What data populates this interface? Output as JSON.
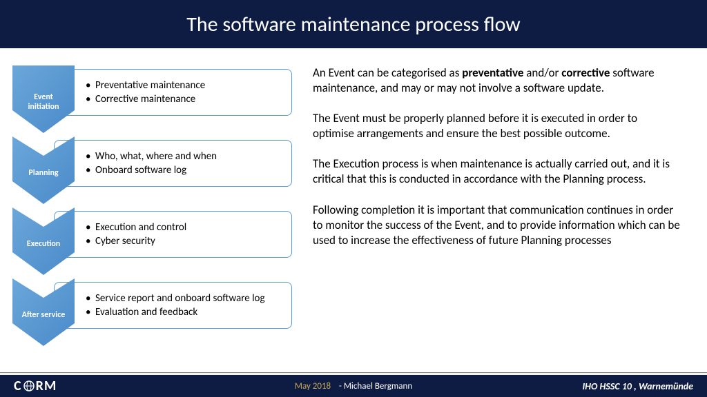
{
  "title": "The software maintenance process flow",
  "steps": [
    {
      "label": "Event\ninitiation",
      "bullets": [
        "Preventative maintenance",
        "Corrective maintenance"
      ]
    },
    {
      "label": "Planning",
      "bullets": [
        "Who, what, where and when",
        "Onboard software log"
      ]
    },
    {
      "label": "Execution",
      "bullets": [
        "Execution and control",
        "Cyber security"
      ]
    },
    {
      "label": "After service",
      "bullets": [
        "Service report and onboard software log",
        "Evaluation and feedback"
      ]
    }
  ],
  "paragraphs": [
    "An Event can be categorised as <b>preventative</b> and/or <b>corrective</b> software maintenance, and may or may not involve a software update.",
    "The Event must be properly planned before it is executed in order to optimise arrangements and ensure the best possible outcome.",
    "The Execution process is when maintenance is actually carried out, and it is critical that this is conducted in accordance with the Planning process.",
    "Following completion it is important that communication continues in order to monitor the success of the Event, and to provide information which can be used to increase the effectiveness of future Planning processes"
  ],
  "footer": {
    "logo_text_left": "C",
    "logo_text_right": "RM",
    "date": "May 2018",
    "author": "- Michael Bergmann",
    "right": "IHO HSSC 10 , Warnemünde"
  }
}
